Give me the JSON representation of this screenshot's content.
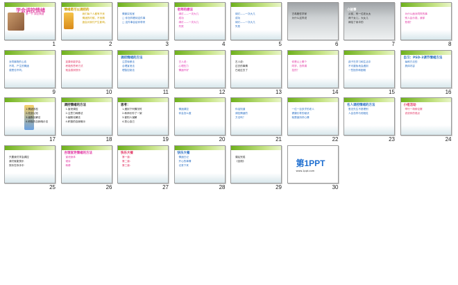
{
  "slides": [
    {
      "num": "1",
      "title": "学会调控情绪",
      "lines": [
        "第一节 调控情绪"
      ],
      "color": "#e040a0"
    },
    {
      "num": "2",
      "title": "情绪是可以调控的",
      "lines": [
        "我们每个人都有不良",
        "情绪的时候，不良情",
        "绪会对我们产生影响。"
      ],
      "color": "#d0a000"
    },
    {
      "num": "3",
      "title": "",
      "lines": [
        "情景实验室",
        "□ 你怎样看待这件事",
        "□ 这件事会给你带来"
      ],
      "color": "#2a6fc4"
    },
    {
      "num": "4",
      "title": "老师的想法",
      "lines": [
        "绿灯——一次大几",
        "成功",
        "绿灯——一次大几",
        "失败"
      ],
      "color": "#e030b0"
    },
    {
      "num": "5",
      "title": "",
      "lines": [
        "绿灯——一次大几",
        "成功",
        "绿灯——一次大几",
        "失败"
      ],
      "color": "#2a6fc4"
    },
    {
      "num": "6",
      "title": "",
      "lines": [
        "古希腊哲学家",
        "为什么这样说"
      ],
      "color": "#ffffff"
    },
    {
      "num": "7",
      "title": "小故事",
      "lines": [
        "从前，有一位老太太",
        "两个女儿，大女儿",
        "嫁给了卖伞的"
      ],
      "color": "#ffffff"
    },
    {
      "num": "8",
      "title": "",
      "lines": [
        "为什么面对同样的事",
        "别人会乐观，我却",
        "悲观？"
      ],
      "color": "#e030a0"
    },
    {
      "num": "9",
      "title": "",
      "lines": [
        "对同事物的心态",
        "不同，产生的情绪",
        "感受也不同。"
      ],
      "color": "#2a6fc4"
    },
    {
      "num": "10",
      "title": "",
      "lines": [
        "如果你能学会",
        "积极的思考方式",
        "就会感到快乐"
      ],
      "color": "#e03060"
    },
    {
      "num": "11",
      "title": "调控情绪的方法",
      "lines": [
        "注意转移法",
        "合理宣泄法",
        "理智控制法"
      ],
      "color": "#2a6fc4"
    },
    {
      "num": "12",
      "title": "",
      "lines": [
        "古人说：",
        "心理压力",
        "情绪不好"
      ],
      "color": "#e030b0"
    },
    {
      "num": "13",
      "title": "",
      "lines": [
        "古人说：",
        "过去的事情",
        "已经过去了"
      ],
      "color": "#222222"
    },
    {
      "num": "14",
      "title": "",
      "lines": [
        "你是以上哪个",
        "同学，怎样调",
        "控的？"
      ],
      "color": "#e030a0"
    },
    {
      "num": "15",
      "title": "",
      "lines": [
        "孩子在学习和生活中",
        "不可避免地会遇到",
        "一些挫折和困难"
      ],
      "color": "#2a6fc4"
    },
    {
      "num": "16",
      "title": "自习：PSD-3调节情绪方法",
      "lines": [
        "每种方法的",
        "具体内容"
      ],
      "color": "#2a6fc4"
    },
    {
      "num": "17",
      "title": "",
      "lines": [
        "1.情绪放松",
        "2.改变认知",
        "3.幽默化解法",
        "4.积极的自我暗示法"
      ],
      "color": "#222222"
    },
    {
      "num": "18",
      "title": "调控情绪的方法",
      "lines": [
        "1.宣泄调控",
        "2.注意力转移法",
        "3.幽默化解法",
        "4.积极的自我暗示"
      ],
      "color": "#222222"
    },
    {
      "num": "19",
      "title": "思考：",
      "lines": [
        "1.遇到下列情况时",
        "2.和师长吵了一架",
        "3.被别人误解",
        "4.担心自己"
      ],
      "color": "#222222"
    },
    {
      "num": "20",
      "title": "",
      "lines": [
        "情绪调控",
        "你会怎么做"
      ],
      "color": "#2a6fc4"
    },
    {
      "num": "21",
      "title": "",
      "lines": [
        "你话知道",
        "调控情绪的",
        "方法吗？"
      ],
      "color": "#2a6fc4"
    },
    {
      "num": "22",
      "title": "",
      "lines": [
        "一位一百多岁的老人",
        "健康长寿的秘诀",
        "就是保持好心情"
      ],
      "color": "#2a6fc4"
    },
    {
      "num": "23",
      "title": "名人调控情绪的方法",
      "lines": [
        "鲁迅先生不愿理别",
        "人会怎样与他相处"
      ],
      "color": "#2a6fc4"
    },
    {
      "num": "24",
      "title": "小组活动",
      "lines": [
        "举行一场辩论赛",
        "说说你的观点"
      ],
      "color": "#e03060"
    },
    {
      "num": "25",
      "title": "",
      "lines": [
        "只要我们学会调控",
        "我们就能快乐",
        "快乐在你手中"
      ],
      "color": "#222222"
    },
    {
      "num": "26",
      "title": "合理宣泄情绪的方法",
      "lines": [
        "宣泄身体",
        "倾诉",
        "转移"
      ],
      "color": "#e030a0"
    },
    {
      "num": "27",
      "title": "快乐大餐",
      "lines": [
        "第一道：",
        "第二道：",
        "第三道："
      ],
      "color": "#e03060"
    },
    {
      "num": "28",
      "title": "快乐大餐",
      "lines": [
        "情绪日记",
        "开心的事情",
        "记录下来"
      ],
      "color": "#2a6fc4"
    },
    {
      "num": "29",
      "title": "",
      "lines": [
        "课后完成",
        "《自测》"
      ],
      "color": "#222222"
    },
    {
      "num": "30",
      "title": "第1PPT",
      "lines": [
        "www.1ppt.com"
      ],
      "color": "#1f6fd0"
    }
  ]
}
